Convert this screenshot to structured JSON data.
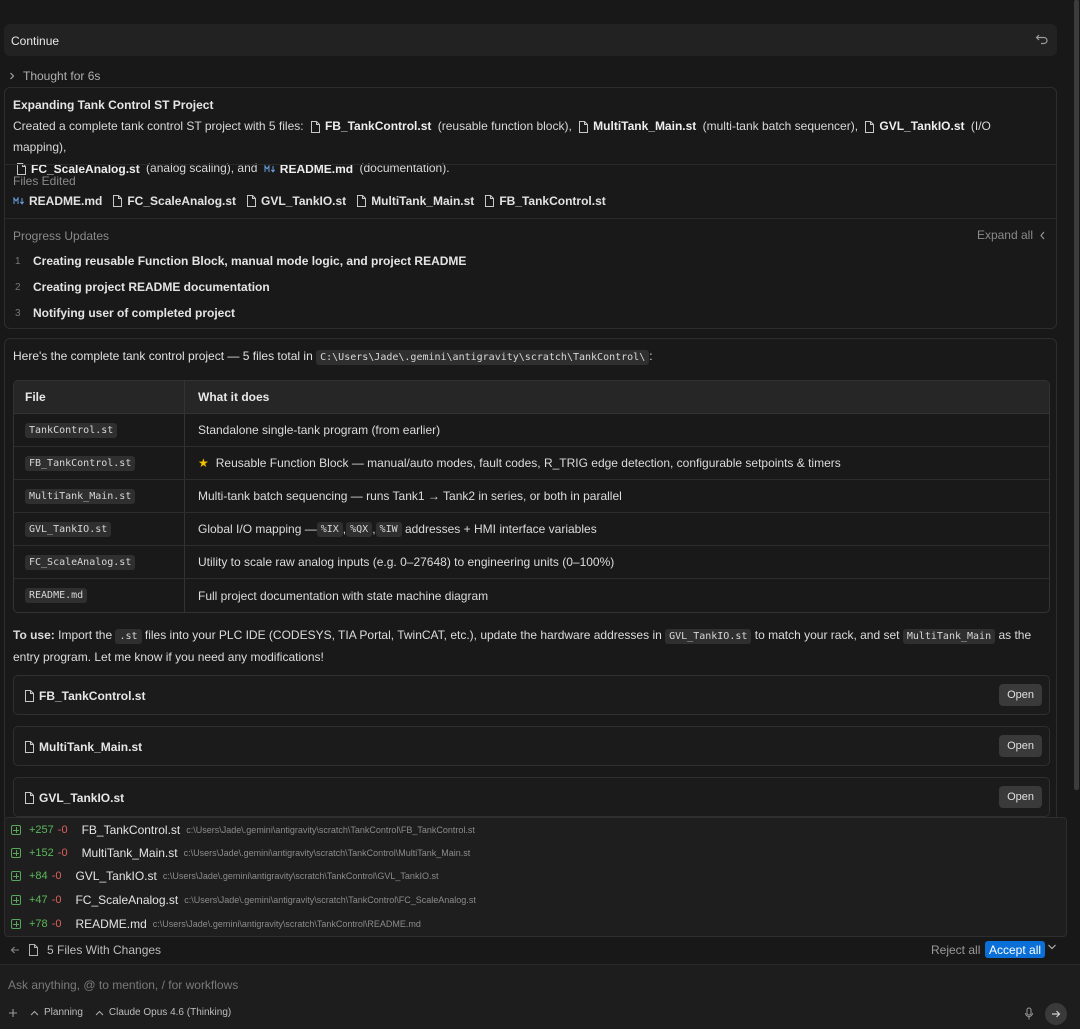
{
  "continue_bar": {
    "label": "Continue"
  },
  "thought": {
    "label": "Thought for 6s"
  },
  "summary": {
    "title": "Expanding Tank Control ST Project",
    "desc_prefix": "Created a complete tank control ST project with 5 files:",
    "desc_items": [
      {
        "file": "FB_TankControl.st",
        "note": "(reusable function block),",
        "icon": "file-icon"
      },
      {
        "file": "MultiTank_Main.st",
        "note": "(multi-tank batch sequencer),",
        "icon": "file-icon"
      },
      {
        "file": "GVL_TankIO.st",
        "note": "(I/O mapping),",
        "icon": "file-icon"
      },
      {
        "file": "FC_ScaleAnalog.st",
        "note": "(analog scaling), and",
        "icon": "file-icon"
      },
      {
        "file": "README.md",
        "note": "(documentation).",
        "icon": "markdown-icon"
      }
    ],
    "files_edited_label": "Files Edited",
    "files_edited": [
      {
        "name": "README.md",
        "icon": "markdown-icon"
      },
      {
        "name": "FC_ScaleAnalog.st",
        "icon": "file-icon"
      },
      {
        "name": "GVL_TankIO.st",
        "icon": "file-icon"
      },
      {
        "name": "MultiTank_Main.st",
        "icon": "file-icon"
      },
      {
        "name": "FB_TankControl.st",
        "icon": "file-icon"
      }
    ],
    "progress_label": "Progress Updates",
    "expand_all": "Expand all",
    "steps": [
      {
        "num": "1",
        "text": "Creating reusable Function Block, manual mode logic, and project README"
      },
      {
        "num": "2",
        "text": "Creating project README documentation"
      },
      {
        "num": "3",
        "text": "Notifying user of completed project"
      }
    ]
  },
  "response": {
    "intro_text": "Here's the complete tank control project — 5 files total in",
    "intro_path": "C:\\Users\\Jade\\.gemini\\antigravity\\scratch\\TankControl\\",
    "intro_end": ":",
    "table": {
      "headers": [
        "File",
        "What it does"
      ],
      "rows": [
        {
          "file": "TankControl.st",
          "desc": "Standalone single-tank program (from earlier)"
        },
        {
          "file": "FB_TankControl.st",
          "star": "★",
          "desc": "Reusable Function Block — manual/auto modes, fault codes, R_TRIG edge detection, configurable setpoints & timers"
        },
        {
          "file": "MultiTank_Main.st",
          "desc": "Multi-tank batch sequencing — runs Tank1 → Tank2 in series, or both in parallel"
        },
        {
          "file": "GVL_TankIO.st",
          "desc_parts": [
            "Global I/O mapping — ",
            "%IX",
            ", ",
            "%QX",
            ", ",
            "%IW",
            " addresses + HMI interface variables"
          ]
        },
        {
          "file": "FC_ScaleAnalog.st",
          "desc": "Utility to scale raw analog inputs (e.g. 0–27648) to engineering units (0–100%)"
        },
        {
          "file": "README.md",
          "desc": "Full project documentation with state machine diagram"
        }
      ]
    },
    "to_use": {
      "bold": "To use:",
      "t1": " Import the ",
      "c1": ".st",
      "t2": " files into your PLC IDE (CODESYS, TIA Portal, TwinCAT, etc.), update the hardware addresses in ",
      "c2": "GVL_TankIO.st",
      "t3": " to match your rack, and set ",
      "c3": "MultiTank_Main",
      "t4": " as the entry program. Let me know if you need any modifications!"
    },
    "cards": [
      {
        "name": "FB_TankControl.st",
        "button": "Open"
      },
      {
        "name": "MultiTank_Main.st",
        "button": "Open"
      },
      {
        "name": "GVL_TankIO.st",
        "button": "Open"
      }
    ]
  },
  "diffs": [
    {
      "adds": "+257",
      "dels": "-0",
      "name": "FB_TankControl.st",
      "path": "c:\\Users\\Jade\\.gemini\\antigravity\\scratch\\TankControl\\FB_TankControl.st"
    },
    {
      "adds": "+152",
      "dels": "-0",
      "name": "MultiTank_Main.st",
      "path": "c:\\Users\\Jade\\.gemini\\antigravity\\scratch\\TankControl\\MultiTank_Main.st"
    },
    {
      "adds": "+84",
      "dels": "-0",
      "name": "GVL_TankIO.st",
      "path": "c:\\Users\\Jade\\.gemini\\antigravity\\scratch\\TankControl\\GVL_TankIO.st"
    },
    {
      "adds": "+47",
      "dels": "-0",
      "name": "FC_ScaleAnalog.st",
      "path": "c:\\Users\\Jade\\.gemini\\antigravity\\scratch\\TankControl\\FC_ScaleAnalog.st"
    },
    {
      "adds": "+78",
      "dels": "-0",
      "name": "README.md",
      "path": "c:\\Users\\Jade\\.gemini\\antigravity\\scratch\\TankControl\\README.md"
    }
  ],
  "changes_bar": {
    "label": "5 Files With Changes",
    "reject": "Reject all",
    "accept": "Accept all"
  },
  "input": {
    "placeholder": "Ask anything, @ to mention, / for workflows",
    "mode": "Planning",
    "model": "Claude Opus 4.6 (Thinking)"
  },
  "colors": {
    "accent": "#0a70d8",
    "added": "#5cb85c",
    "removed": "#e06060",
    "star": "#f2c200"
  }
}
